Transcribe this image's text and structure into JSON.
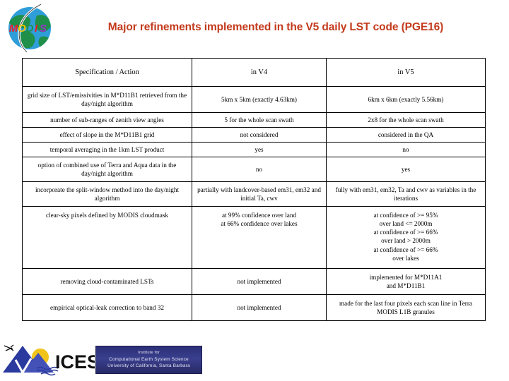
{
  "header": {
    "logo_name": "MODIS",
    "logo_letters": [
      "M",
      "O",
      "D",
      "I",
      "S"
    ],
    "title": "Major refinements implemented in the V5 daily LST code (PGE16)",
    "title_color": "#c33a1c"
  },
  "table": {
    "columns": [
      "Specification / Action",
      "in V4",
      "in V5"
    ],
    "rows": [
      {
        "spec": "grid size of LST/emissivities in M*D11B1 retrieved from the day/night algorithm",
        "v4": "5km x 5km (exactly 4.63km)",
        "v5": "6km x 6km (exactly 5.56km)"
      },
      {
        "spec": "number of sub-ranges of zenith view angles",
        "v4": "5 for the whole scan swath",
        "v5": "2x8 for the whole scan swath"
      },
      {
        "spec": "effect of slope in the M*D11B1 grid",
        "v4": "not considered",
        "v5": "considered in the QA"
      },
      {
        "spec": "temporal averaging in the 1km LST product",
        "v4": "yes",
        "v5": "no"
      },
      {
        "spec": "option of combined use of Terra and Aqua data in the day/night algorithm",
        "v4": "no",
        "v5": "yes"
      },
      {
        "spec": "incorporate the split-window method into the day/night algorithm",
        "v4": "partially with landcover-based em31, em32 and initial Ta, cwv",
        "v5": "fully with em31, em32, Ta and cwv as variables in the iterations"
      },
      {
        "spec": "clear-sky pixels defined by MODIS cloudmask",
        "v4": "at 99% confidence over land\nat 66% confidence over lakes",
        "v5": "at confidence of >= 95%\n over land  <= 2000m\nat confidence of >= 66%\n over land > 2000m\nat confidence of >= 66%\n over lakes"
      },
      {
        "spec": "removing cloud-contaminated LSTs",
        "v4": "not implemented",
        "v5": "implemented for M*D11A1\nand M*D11B1"
      },
      {
        "spec": "empirical optical-leak correction to band 32",
        "v4": "not implemented",
        "v5": "made for the last four pixels each scan line in Terra MODIS L1B granules"
      }
    ]
  },
  "footer": {
    "logo_text": "ICESS",
    "banner_line1": "Institute for",
    "banner_line2": "Computational Earth System Science",
    "banner_line3": "University of California, Santa Barbara"
  }
}
